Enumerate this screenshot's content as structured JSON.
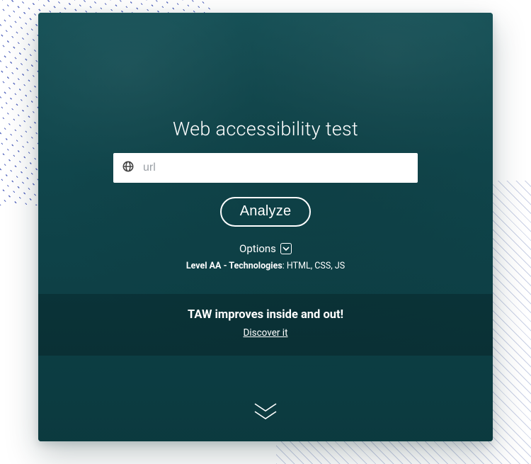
{
  "hero": {
    "title": "Web accessibility test",
    "url_input": {
      "value": "",
      "placeholder": "url"
    },
    "analyze_label": "Analyze",
    "options_label": "Options",
    "tech_prefix_bold": "Level AA - Technologies",
    "tech_suffix": ": HTML, CSS, JS"
  },
  "band": {
    "headline": "TAW improves inside and out!",
    "cta": "Discover it"
  },
  "icons": {
    "globe": "globe-icon",
    "options_toggle": "options-dropdown-icon",
    "scroll_down": "scroll-down-chevrons"
  }
}
